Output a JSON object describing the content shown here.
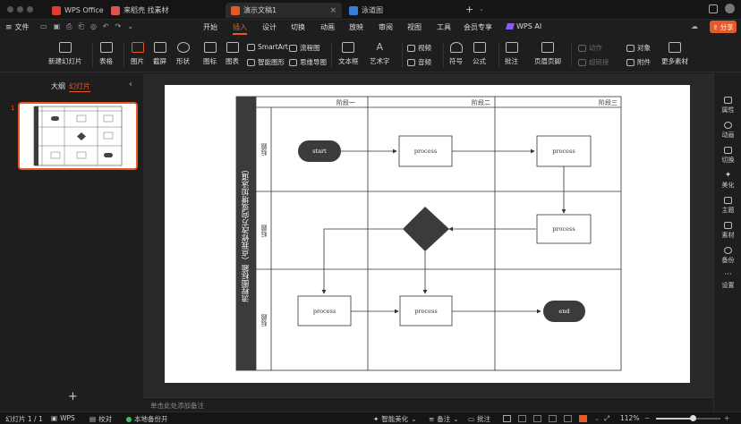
{
  "titlebar": {
    "tabs": [
      {
        "label": "WPS Office",
        "color": "#e03c31"
      },
      {
        "label": "来稻壳 找素材",
        "color": "#d9534f"
      },
      {
        "label": "演示文稿1",
        "color": "#e65a2a"
      },
      {
        "label": "泳道图",
        "color": "#3b7be0"
      }
    ],
    "new_tab": "+"
  },
  "menubar": {
    "file_label": "文件",
    "tabs": [
      "开始",
      "插入",
      "设计",
      "切换",
      "动画",
      "放映",
      "审阅",
      "视图",
      "工具",
      "会员专享",
      "WPS AI"
    ],
    "active_tab": "插入",
    "share_label": "分享"
  },
  "ribbon": {
    "new_slide": "新建幻灯片",
    "table": "表格",
    "picture": "图片",
    "screenshot": "截屏",
    "shape": "形状",
    "icon": "图标",
    "chart": "图表",
    "smartart": "SmartArt",
    "smart_shape": "智能图形",
    "flowchart": "流程图",
    "mindmap": "思维导图",
    "textbox": "文本框",
    "wordart": "艺术字",
    "video": "视频",
    "audio": "音频",
    "symbol": "符号",
    "formula": "公式",
    "comment": "批注",
    "header_footer": "页眉页脚",
    "action": "动作",
    "hyperlink": "超链接",
    "object": "对象",
    "attachment": "附件",
    "more_material": "更多素材"
  },
  "leftpanel": {
    "outline_tab": "大纲",
    "slides_tab": "幻灯片",
    "slide_number": "1",
    "add": "+"
  },
  "swimlane": {
    "title": "流程图标题（点我修改方向或增加泳道）",
    "phases": [
      "阶段一",
      "阶段二",
      "阶段三"
    ],
    "lanes": [
      "标题",
      "标题",
      "标题"
    ],
    "nodes": {
      "start": "start",
      "process1": "process",
      "process2": "process",
      "process3": "process",
      "process4": "process",
      "process5": "process",
      "end": "end"
    }
  },
  "notes_placeholder": "单击此处添加备注",
  "rightbar": [
    "属性",
    "动画",
    "切换",
    "美化",
    "主题",
    "素材",
    "备份",
    "设置"
  ],
  "statusbar": {
    "slide_info": "幻灯片 1 / 1",
    "wps": "WPS",
    "proofread": "校对",
    "backup": "本地备份开",
    "beautify": "智能美化",
    "notes": "备注",
    "comments": "批注",
    "zoom": "112%"
  }
}
